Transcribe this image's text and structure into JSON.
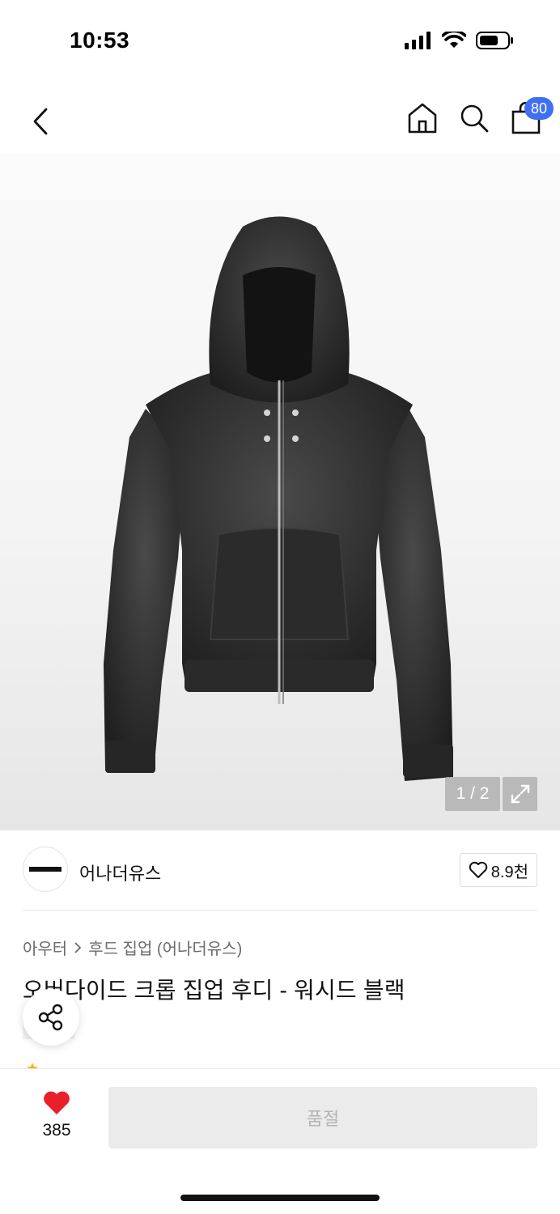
{
  "status_bar": {
    "time": "10:53"
  },
  "nav": {
    "cart_count": "80"
  },
  "gallery": {
    "counter": "1 / 2"
  },
  "brand": {
    "name": "어나더유스",
    "like_count": "8.9천"
  },
  "breadcrumb": {
    "category": "아우터",
    "subcategory": "후드 집업 (어나더유스)"
  },
  "product": {
    "title": "오버다이드 크롭 집업 후디 - 워시드 블랙"
  },
  "bottom": {
    "like_count": "385",
    "action_label": "품절"
  },
  "colors": {
    "accent": "#3f6ff2",
    "heart": "#e8202a",
    "disabled_bg": "#ebebeb"
  }
}
